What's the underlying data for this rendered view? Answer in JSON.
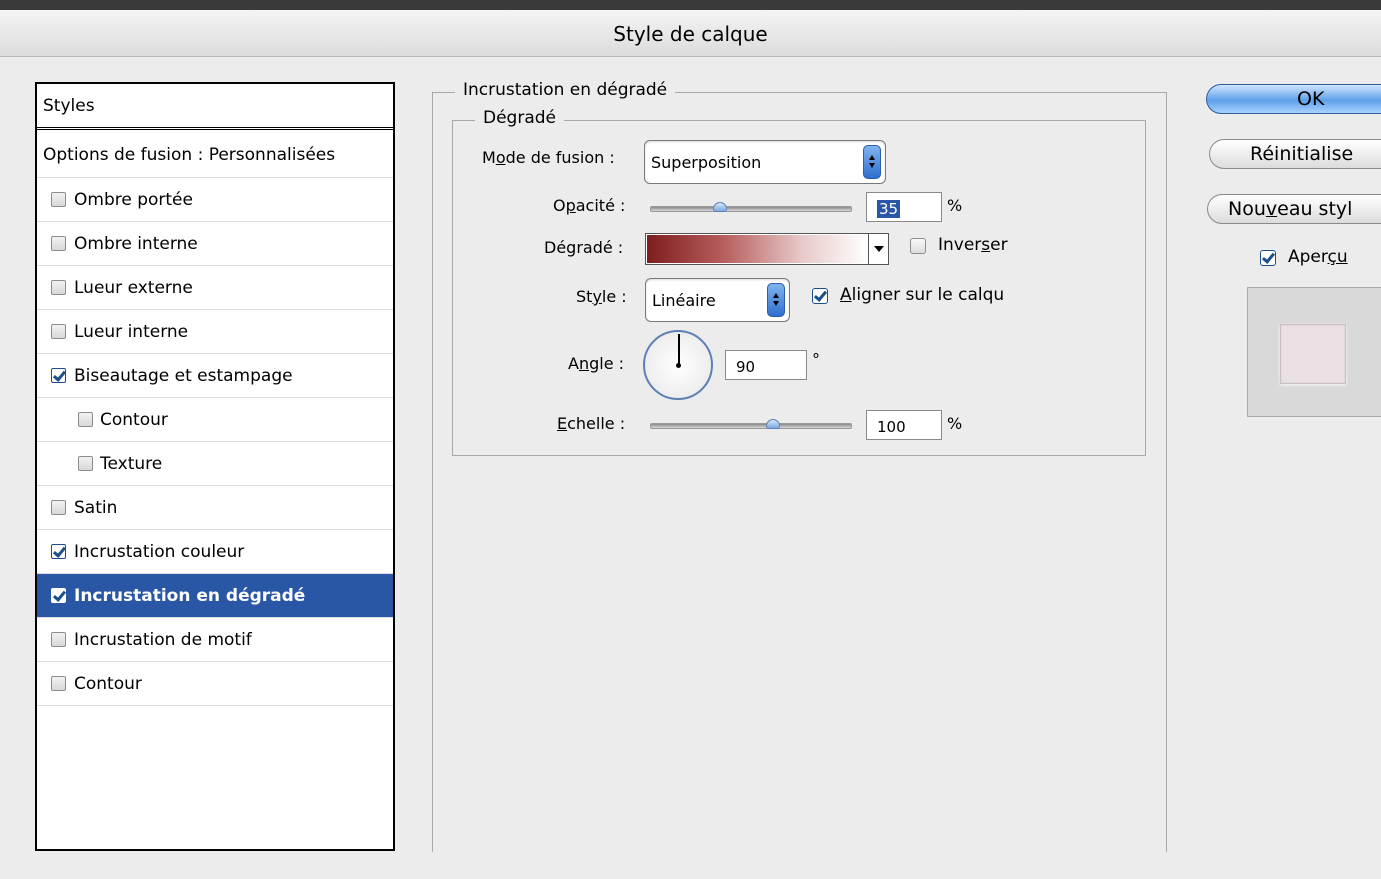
{
  "window": {
    "title": "Style de calque"
  },
  "styles_list": {
    "header": "Styles",
    "blending_options": "Options de fusion : Personnalisées",
    "items": [
      {
        "label": "Ombre portée",
        "checked": false
      },
      {
        "label": "Ombre interne",
        "checked": false
      },
      {
        "label": "Lueur externe",
        "checked": false
      },
      {
        "label": "Lueur interne",
        "checked": false
      },
      {
        "label": "Biseautage et estampage",
        "checked": true
      },
      {
        "label": "Contour",
        "checked": false
      },
      {
        "label": "Texture",
        "checked": false
      },
      {
        "label": "Satin",
        "checked": false
      },
      {
        "label": "Incrustation couleur",
        "checked": true
      },
      {
        "label": "Incrustation en dégradé",
        "checked": true,
        "selected": true
      },
      {
        "label": "Incrustation de motif",
        "checked": false
      },
      {
        "label": "Contour",
        "checked": false
      }
    ]
  },
  "panel": {
    "group_title": "Incrustation en dégradé",
    "subgroup_title": "Dégradé",
    "blend_mode": {
      "label": "Mode de fusion :",
      "value": "Superposition"
    },
    "opacity": {
      "label": "Opacité :",
      "value": "35",
      "unit": "%",
      "level_percent": 35
    },
    "gradient": {
      "label": "Dégradé :",
      "colors": [
        "#7e1d1d",
        "#b85e5e",
        "#e7c8c8",
        "#ffffff"
      ]
    },
    "reverse": {
      "label": "Inverser",
      "checked": false
    },
    "style": {
      "label": "Style :",
      "value": "Linéaire"
    },
    "align_with_layer": {
      "label": "Aligner sur le calqu",
      "checked": true
    },
    "angle": {
      "label": "Angle :",
      "value": "90",
      "unit": "°"
    },
    "scale": {
      "label": "Echelle :",
      "value": "100",
      "unit": "%",
      "level_percent": 100
    }
  },
  "buttons": {
    "ok": "OK",
    "reset": "Réinitialise",
    "new_style": "Nouveau styl"
  },
  "preview": {
    "label": "Aperçu",
    "checked": true,
    "swatch_color": "#ebe0e3"
  },
  "colors": {
    "selection": "#2a57a5",
    "accent": "#5fa0ea"
  }
}
